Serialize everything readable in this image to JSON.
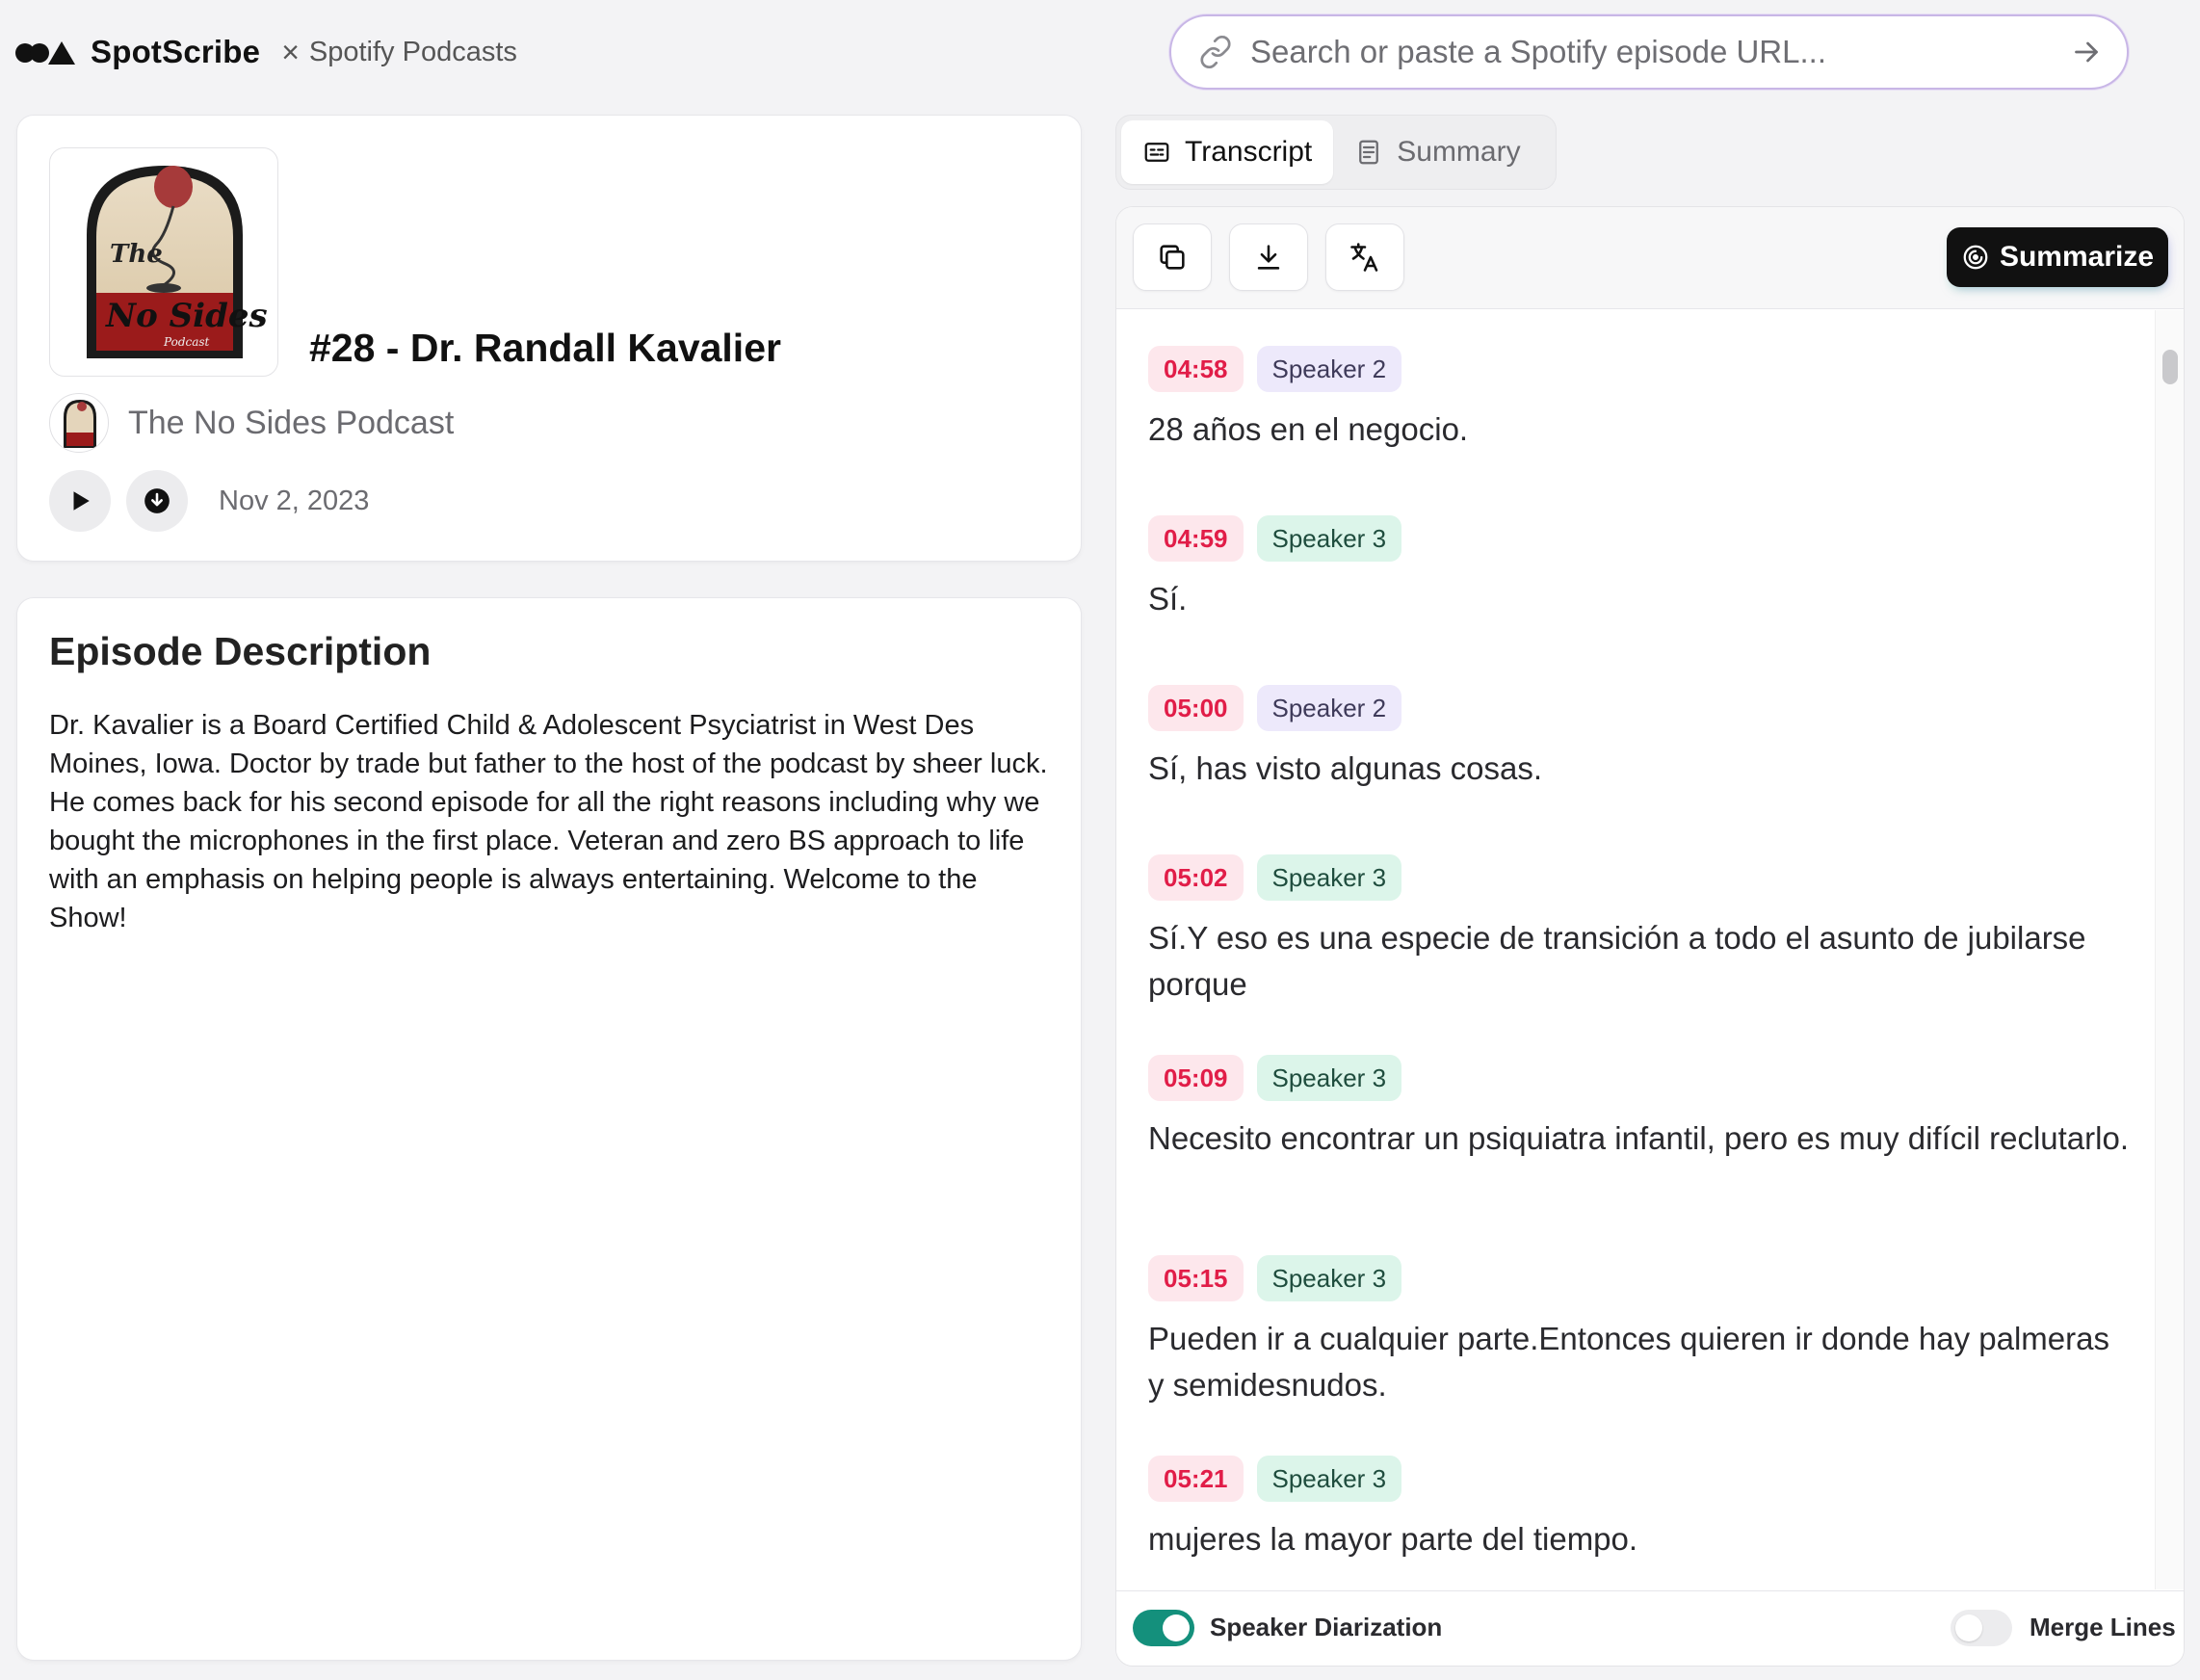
{
  "header": {
    "brand_name": "SpotScribe",
    "separator": "×",
    "section": "Spotify Podcasts",
    "search": {
      "placeholder": "Search or paste a Spotify episode URL...",
      "value": ""
    },
    "search_border_color": "#c8b6e6"
  },
  "episode": {
    "title": "#28 - Dr. Randall Kavalier",
    "podcast_name": "The No Sides Podcast",
    "date": "Nov 2, 2023",
    "cover_text": {
      "line1": "The",
      "line2": "No Sides",
      "line3": "Podcast"
    },
    "icons": [
      "play-icon",
      "download-icon"
    ]
  },
  "description": {
    "heading": "Episode Description",
    "text": "Dr. Kavalier is a Board Certified Child & Adolescent Psyciatrist in West Des Moines, Iowa. Doctor by trade but father to the host of the podcast by sheer luck. He comes back for his second episode for all the right reasons including why we bought the microphones in the first place. Veteran and zero BS approach to life with an emphasis on helping people is always entertaining. Welcome to the Show!"
  },
  "tabs": [
    {
      "label": "Transcript",
      "active": true,
      "icon": "captions-icon"
    },
    {
      "label": "Summary",
      "active": false,
      "icon": "document-icon"
    }
  ],
  "toolbar": {
    "icons": [
      "copy-icon",
      "download-icon",
      "translate-icon"
    ],
    "summarize_label": "Summarize"
  },
  "transcript": [
    {
      "time": "04:58",
      "speaker": "Speaker 2",
      "text": "28 años en el negocio."
    },
    {
      "time": "04:59",
      "speaker": "Speaker 3",
      "text": "Sí."
    },
    {
      "time": "05:00",
      "speaker": "Speaker 2",
      "text": "Sí, has visto algunas cosas."
    },
    {
      "time": "05:02",
      "speaker": "Speaker 3",
      "text": "Sí.Y eso es una especie de transición a todo el asunto de jubilarse porque"
    },
    {
      "time": "05:09",
      "speaker": "Speaker 3",
      "text": "Necesito encontrar un psiquiatra infantil, pero es muy difícil reclutarlo."
    },
    {
      "time": "05:15",
      "speaker": "Speaker 3",
      "text": "Pueden ir a cualquier parte.Entonces quieren ir donde hay palmeras y semidesnudos."
    },
    {
      "time": "05:21",
      "speaker": "Speaker 3",
      "text": "mujeres la mayor parte del tiempo."
    }
  ],
  "footer": {
    "speaker_diarization": {
      "label": "Speaker Diarization",
      "on": true
    },
    "merge_lines": {
      "label": "Merge Lines",
      "on": false
    }
  },
  "colors": {
    "timestamp_bg": "#fde7ec",
    "timestamp_text": "#e11d48",
    "speaker2_bg": "#ede9fb",
    "speaker3_bg": "#dcf5ea",
    "toggle_on": "#14907c"
  }
}
